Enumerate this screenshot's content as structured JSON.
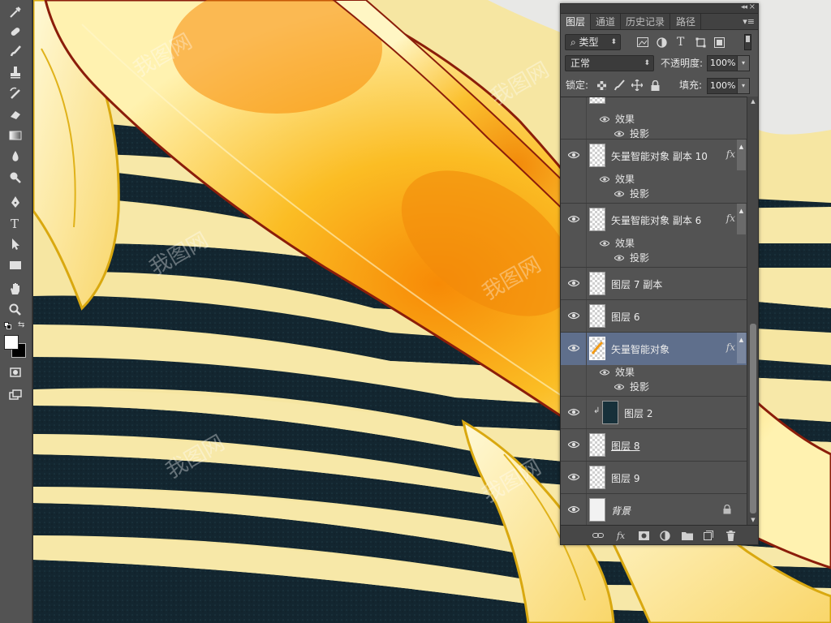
{
  "panel": {
    "tabs": [
      {
        "label": "图层",
        "active": true
      },
      {
        "label": "通道",
        "active": false
      },
      {
        "label": "历史记录",
        "active": false
      },
      {
        "label": "路径",
        "active": false
      }
    ],
    "filter_kind": "类型",
    "blend_mode": "正常",
    "opacity_label": "不透明度:",
    "opacity_value": "100%",
    "lock_label": "锁定:",
    "fill_label": "填充:",
    "fill_value": "100%"
  },
  "layers": [
    {
      "name": "效果",
      "kind": "effects-header"
    },
    {
      "name": "投影",
      "kind": "effect"
    },
    {
      "name": "矢量智能对象 副本 10",
      "kind": "smart-object",
      "fx": "fx",
      "effects_label": "效果",
      "effect_label": "投影"
    },
    {
      "name": "矢量智能对象 副本 6",
      "kind": "smart-object",
      "fx": "fx",
      "effects_label": "效果",
      "effect_label": "投影"
    },
    {
      "name": "图层 7 副本",
      "kind": "layer"
    },
    {
      "name": "图层 6",
      "kind": "layer"
    },
    {
      "name": "矢量智能对象",
      "kind": "smart-object",
      "fx": "fx",
      "selected": true,
      "effects_label": "效果",
      "effect_label": "投影"
    },
    {
      "name": "图层 2",
      "kind": "clipped-layer"
    },
    {
      "name": "图层 8",
      "kind": "layer"
    },
    {
      "name": "图层 9",
      "kind": "layer"
    },
    {
      "name": "背景",
      "kind": "background",
      "locked": true
    }
  ],
  "tools": [
    "eyedropper-icon",
    "healing-brush-icon",
    "brush-icon",
    "clone-stamp-icon",
    "history-brush-icon",
    "eraser-icon",
    "gradient-icon",
    "blur-icon",
    "dodge-icon",
    "pen-icon",
    "type-icon",
    "path-selection-icon",
    "rectangle-icon",
    "hand-icon",
    "zoom-icon"
  ],
  "watermark": "我图网",
  "colors": {
    "panel_bg": "#535353",
    "selected_layer": "#5f6f8c",
    "canvas_cream": "#f6e6a2",
    "canvas_dark": "#15262e",
    "feather_orange": "#f79a0d",
    "feather_outline": "#8b1d0a"
  }
}
